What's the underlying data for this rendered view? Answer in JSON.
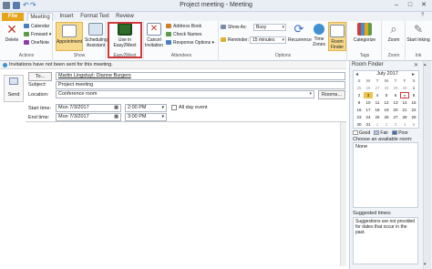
{
  "window": {
    "title": "Project meeting - Meeting",
    "minimize": "–",
    "maximize": "□",
    "close": "✕"
  },
  "tabs": [
    "File",
    "Meeting",
    "Insert",
    "Format Text",
    "Review"
  ],
  "ribbon": {
    "actions": {
      "delete": "Delete",
      "calendar": "Calendar",
      "forward": "Forward ▾",
      "onenote": "OneNote",
      "label": "Actions"
    },
    "show": {
      "appointment": "Appointment",
      "scheduling": "Scheduling Assistant",
      "label": "Show"
    },
    "easymeet": {
      "button": "Use in Easy2Meet",
      "label": "Easy2Meet"
    },
    "attendees": {
      "cancel": "Cancel Invitation",
      "address_book": "Address Book",
      "check_names": "Check Names",
      "response_options": "Response Options ▾",
      "label": "Attendees"
    },
    "options": {
      "show_as_label": "Show As:",
      "show_as_value": "Busy",
      "reminder_label": "Reminder:",
      "reminder_value": "15 minutes",
      "recurrence": "Recurrence",
      "time_zones": "Time Zones",
      "room_finder": "Room Finder",
      "label": "Options"
    },
    "tags": {
      "categorize": "Categorize",
      "label": "Tags"
    },
    "zoom": {
      "zoom": "Zoom",
      "label": "Zoom"
    },
    "ink": {
      "start_inking": "Start Inking",
      "label": "Ink"
    }
  },
  "infobar": "Invitations have not been sent for this meeting.",
  "form": {
    "send": "Send",
    "to_button": "To...",
    "to_value": "Martin Lingstuyl; Dianne Burgers",
    "subject_label": "Subject:",
    "subject_value": "Project meeting",
    "location_label": "Location:",
    "location_value": "Conference room",
    "rooms_button": "Rooms...",
    "start_label": "Start time:",
    "start_date": "Mon 7/3/2017",
    "start_time": "2:00 PM",
    "all_day": "All day event",
    "end_label": "End time:",
    "end_date": "Mon 7/3/2017",
    "end_time": "3:00 PM"
  },
  "room_finder": {
    "title": "Room Finder",
    "month": "July 2017",
    "weekdays": [
      "S",
      "M",
      "T",
      "W",
      "T",
      "F",
      "S"
    ],
    "weeks": [
      [
        "25",
        "26",
        "27",
        "28",
        "29",
        "30",
        "1"
      ],
      [
        "2",
        "3",
        "4",
        "5",
        "6",
        "7",
        "8"
      ],
      [
        "9",
        "10",
        "11",
        "12",
        "13",
        "14",
        "15"
      ],
      [
        "16",
        "17",
        "18",
        "19",
        "20",
        "21",
        "22"
      ],
      [
        "23",
        "24",
        "25",
        "26",
        "27",
        "28",
        "29"
      ],
      [
        "30",
        "31",
        "1",
        "2",
        "3",
        "4",
        "5"
      ]
    ],
    "legend": [
      "Good",
      "Fair",
      "Poor"
    ],
    "choose_label": "Choose an available room:",
    "choose_value": "None",
    "suggested_label": "Suggested times:",
    "suggested_text": "Suggestions are not provided for dates that occur in the past."
  }
}
